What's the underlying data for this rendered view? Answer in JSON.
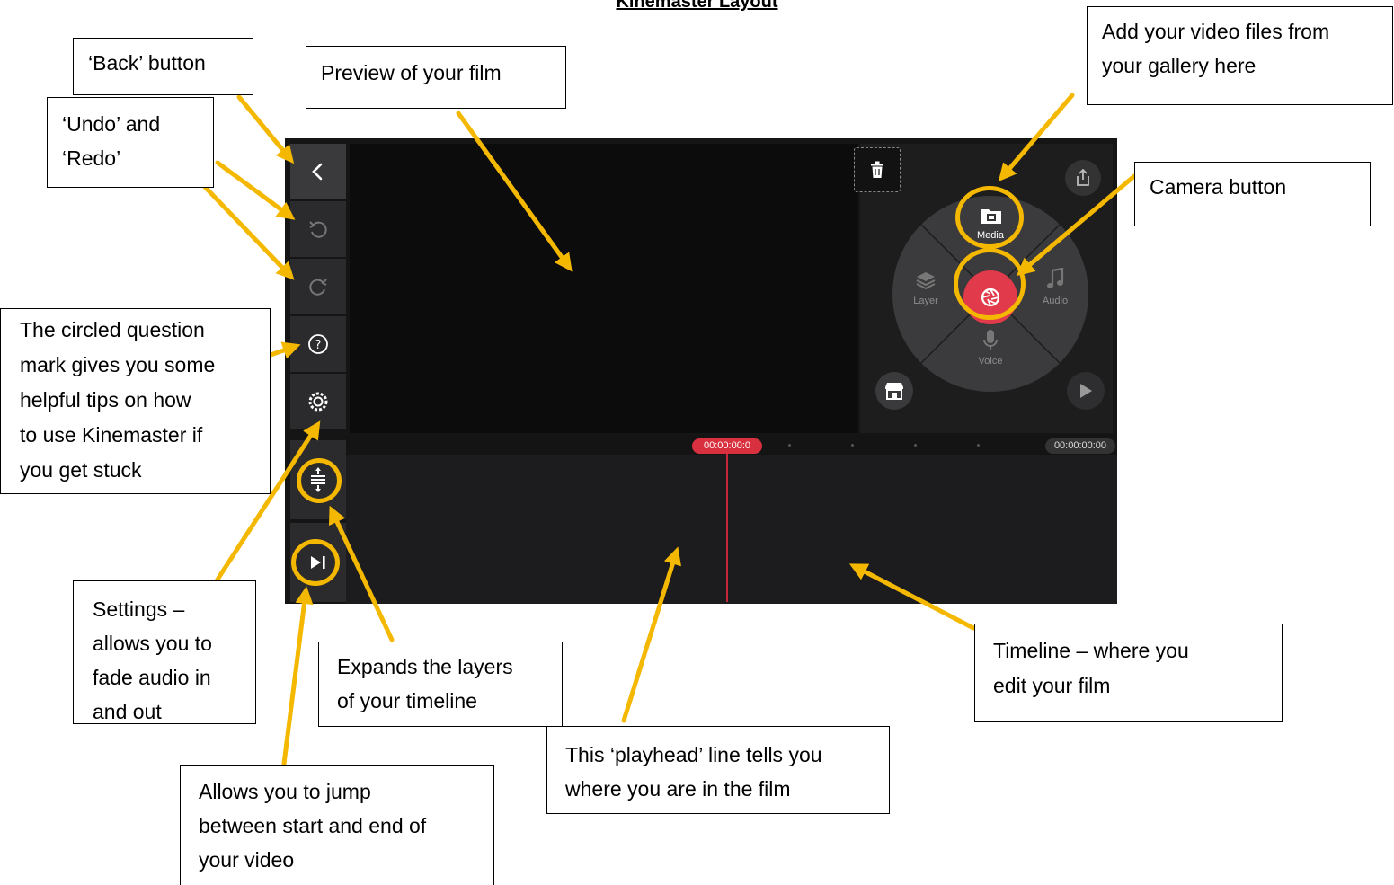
{
  "page": {
    "title": "Kinemaster Layout"
  },
  "app": {
    "preview_timecode": "00:00:00:0",
    "end_timecode": "00:00:00:00",
    "wheel": {
      "media_label": "Media",
      "layer_label": "Layer",
      "audio_label": "Audio",
      "voice_label": "Voice"
    },
    "icons": {
      "back": "chevron-left-icon",
      "undo": "undo-icon",
      "redo": "redo-icon",
      "help": "question-circle-icon",
      "settings": "gear-icon",
      "expand": "expand-layers-icon",
      "jump": "skip-to-end-icon",
      "trash": "trash-icon",
      "share": "share-icon",
      "media": "folder-film-icon",
      "camera": "camera-shutter-icon",
      "layer": "layers-icon",
      "audio": "music-note-icon",
      "voice": "microphone-icon",
      "store": "store-icon",
      "play": "play-icon"
    },
    "colors": {
      "accent_red": "#e13a4a",
      "annotation_yellow": "#f5b800"
    }
  },
  "annotations": {
    "back": "‘Back’ button",
    "undo_redo": [
      "‘Undo’ and",
      "‘Redo’"
    ],
    "preview": "Preview of your film",
    "media": [
      "Add your video files from",
      "your gallery here"
    ],
    "camera": "Camera button",
    "help": [
      "The circled question",
      "mark gives you some",
      "helpful tips on how",
      "to use Kinemaster if",
      "you get stuck"
    ],
    "settings": [
      "Settings –",
      "allows you to",
      "fade audio in",
      "and out"
    ],
    "expand": [
      "Expands the layers",
      "of your timeline"
    ],
    "timeline": [
      "Timeline – where you",
      "edit your film"
    ],
    "playhead": [
      "This ‘playhead’ line tells you",
      "where you are in the film"
    ],
    "jump": [
      "Allows you to jump",
      "between start and end of",
      "your video"
    ]
  }
}
